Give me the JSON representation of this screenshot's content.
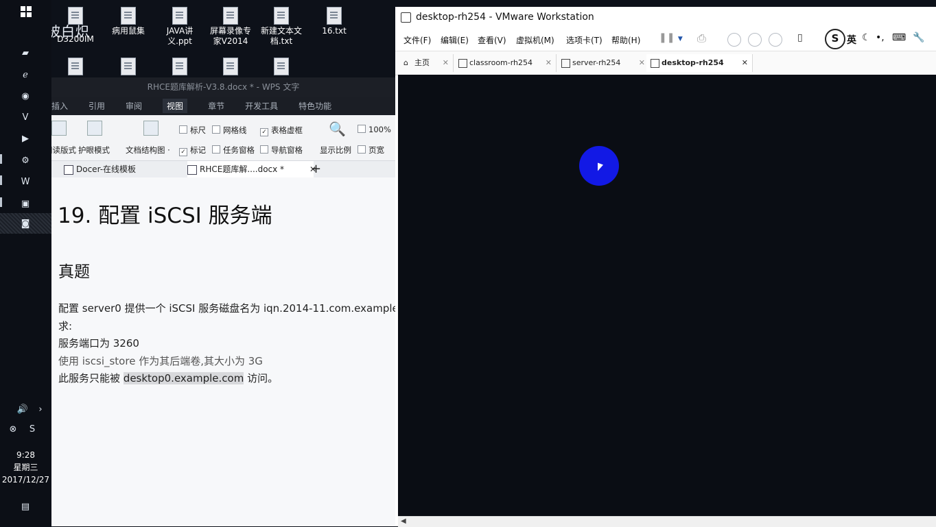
{
  "desktop": {
    "watermark": "温馨被白炽",
    "icons": [
      {
        "label": "D3200IM"
      },
      {
        "label": "病用鼠集"
      },
      {
        "label": "JAVA讲义.ppt"
      },
      {
        "label": "屏幕录像专家V2014"
      },
      {
        "label": "新建文本文档.txt"
      },
      {
        "label": "16.txt"
      }
    ]
  },
  "taskbar": {
    "time": "9:28",
    "weekday": "星期三",
    "date": "2017/12/27"
  },
  "wps": {
    "title": "RHCE题库解析-V3.8.docx * - WPS 文字",
    "menu": [
      "插入",
      "引用",
      "审阅",
      "视图",
      "章节",
      "开发工具",
      "特色功能"
    ],
    "active_menu": "视图",
    "ribbon": {
      "read_mode": "阅读版式",
      "protect_mode": "护眼模式",
      "doc_map": "文档结构图 ·",
      "ruler": "标尺",
      "gridlines": "网格线",
      "table_gridlines": "表格虚框",
      "marks": "标记",
      "task_pane": "任务窗格",
      "nav_pane": "导航窗格",
      "zoom_label": "显示比例",
      "zoom_value": "100%",
      "page_width": "页宽"
    },
    "tabs": [
      {
        "label": "Docer-在线模板"
      },
      {
        "label": "RHCE题库解....docx *"
      }
    ],
    "doc": {
      "heading": "19. 配置 iSCSI 服务端",
      "subheading": "真题",
      "line1": "配置 server0 提供一个 iSCSI 服务磁盘名为 iqn.2014-11.com.example",
      "line2": "求:",
      "line3": "服务端口为 3260",
      "line4": "使用 iscsi_store 作为其后端卷,其大小为 3G",
      "line5_prefix": "此服务只能被",
      "line5_highlight": "desktop0.example.com",
      "line5_suffix": "访问。"
    }
  },
  "vmware": {
    "title": "desktop-rh254 - VMware Workstation",
    "menu": [
      "文件(F)",
      "编辑(E)",
      "查看(V)",
      "虚拟机(M)",
      "选项卡(T)",
      "帮助(H)"
    ],
    "ime_label": "英",
    "tabs": [
      {
        "label": "主页"
      },
      {
        "label": "classroom-rh254"
      },
      {
        "label": "server-rh254"
      },
      {
        "label": "desktop-rh254"
      }
    ],
    "active_tab": "desktop-rh254"
  }
}
